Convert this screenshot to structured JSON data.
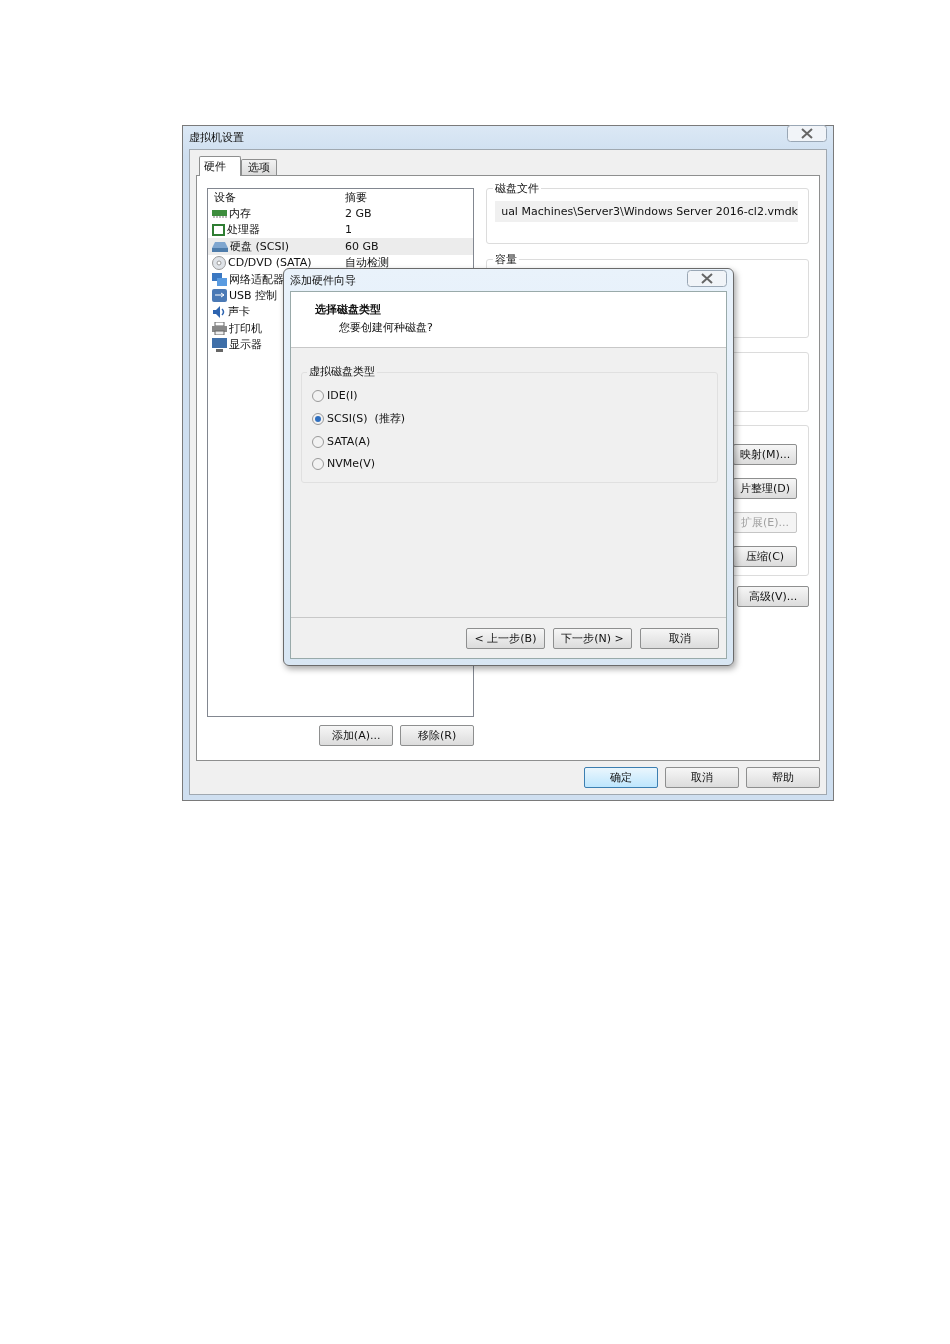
{
  "window": {
    "title": "虚拟机设置"
  },
  "tabs": [
    {
      "label": "硬件",
      "selected": true
    },
    {
      "label": "选项",
      "selected": false
    }
  ],
  "device_list": {
    "columns": [
      "设备",
      "摘要"
    ],
    "rows": [
      {
        "kind": "memory",
        "device": "内存",
        "summary": "2 GB",
        "selected": false
      },
      {
        "kind": "cpu",
        "device": "处理器",
        "summary": "1",
        "selected": false
      },
      {
        "kind": "disk",
        "device": "硬盘 (SCSI)",
        "summary": "60 GB",
        "selected": true
      },
      {
        "kind": "cdrom",
        "device": "CD/DVD (SATA)",
        "summary": "自动检测",
        "selected": false
      },
      {
        "kind": "network",
        "device": "网络适配器",
        "selected": false
      },
      {
        "kind": "usb",
        "device": "USB 控制",
        "selected": false
      },
      {
        "kind": "sound",
        "device": "声卡",
        "selected": false
      },
      {
        "kind": "printer",
        "device": "打印机",
        "selected": false
      },
      {
        "kind": "display",
        "device": "显示器",
        "selected": false
      }
    ]
  },
  "disk_file": {
    "label": "磁盘文件",
    "value": "ual Machines\\Server3\\Windows Server 2016-cl2.vmdk"
  },
  "capacity": {
    "label": "容量"
  },
  "utility_buttons": [
    {
      "label": "映射(M)...",
      "disabled": false
    },
    {
      "label": "片整理(D)",
      "disabled": false
    },
    {
      "label": "扩展(E)...",
      "disabled": true
    },
    {
      "label": "压缩(C)",
      "disabled": false
    }
  ],
  "advanced_button": "高级(V)...",
  "list_buttons": [
    "添加(A)...",
    "移除(R)"
  ],
  "footer_buttons": [
    {
      "label": "确定",
      "default": true
    },
    {
      "label": "取消",
      "default": false
    },
    {
      "label": "帮助",
      "default": false
    }
  ],
  "wizard": {
    "title": "添加硬件向导",
    "heading": "选择磁盘类型",
    "subheading": "您要创建何种磁盘?",
    "group_label": "虚拟磁盘类型",
    "options": [
      {
        "label": "IDE(I)",
        "selected": false
      },
      {
        "label": "SCSI(S)  (推荐)",
        "selected": true
      },
      {
        "label": "SATA(A)",
        "selected": false
      },
      {
        "label": "NVMe(V)",
        "selected": false
      }
    ],
    "buttons": [
      "< 上一步(B)",
      "下一步(N) >",
      "取消"
    ]
  }
}
